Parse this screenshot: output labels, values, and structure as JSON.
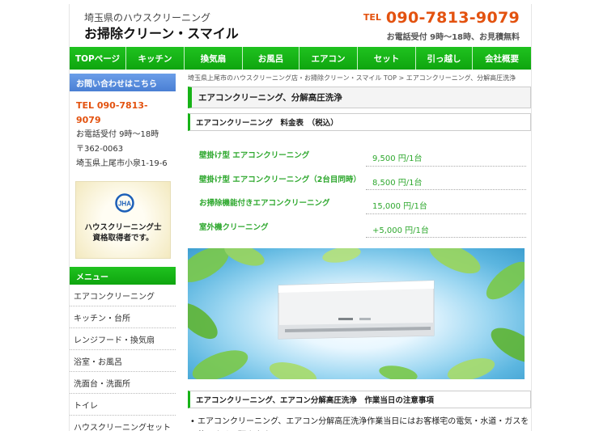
{
  "header": {
    "subtitle": "埼玉県のハウスクリーニング",
    "title": "お掃除クリーン・スマイル",
    "tel_label": "TEL",
    "tel_number": "090-7813-9079",
    "hours": "お電話受付 9時～18時、お見積無料"
  },
  "nav": [
    "TOPページ",
    "キッチン",
    "換気扇",
    "お風呂",
    "エアコン",
    "セット",
    "引っ越し",
    "会社概要"
  ],
  "sidebar": {
    "contact_heading": "お問い合わせはこちら",
    "tel": "TEL 090-7813-9079",
    "hours": "お電話受付 9時〜18時",
    "postal": "〒362-0063",
    "address": "埼玉県上尾市小泉1-19-6",
    "badge_logo": "JHA",
    "badge_line1": "ハウスクリーニング士",
    "badge_line2": "資格取得者です。",
    "menu_heading": "メニュー",
    "menu": [
      "エアコンクリーニング",
      "キッチン・台所",
      "レンジフード・換気扇",
      "浴室・お風呂",
      "洗面台・洗面所",
      "トイレ",
      "ハウスクリーニングセット"
    ]
  },
  "main": {
    "breadcrumb_home": "埼玉県上尾市のハウスクリーニング店・お掃除クリーン・スマイル TOP",
    "breadcrumb_sep": " > ",
    "breadcrumb_current": "エアコンクリーニング、分解高圧洗浄",
    "page_title": "エアコンクリーニング、分解高圧洗浄",
    "price_heading": "エアコンクリーニング　料金表　（税込）",
    "prices": [
      {
        "name": "壁掛け型 エアコンクリーニング",
        "price": "9,500 円/1台"
      },
      {
        "name": "壁掛け型 エアコンクリーニング（2台目同時）",
        "price": "8,500 円/1台"
      },
      {
        "name": "お掃除機能付きエアコンクリーニング",
        "price": "15,000 円/1台"
      },
      {
        "name": "室外機クリーニング",
        "price": "+5,000 円/1台"
      }
    ],
    "notes_heading": "エアコンクリーニング、エアコン分解高圧洗浄　作業当日の注意事項",
    "note1": "エアコンクリーニング、エアコン分解高圧洗浄作業当日にはお客様宅の電気・水道・ガスを使用させて頂きます。"
  },
  "colors": {
    "accent": "#17b317",
    "tel": "#e3520f",
    "price": "#2ea82e",
    "contact_head": "#4a7fd4"
  }
}
